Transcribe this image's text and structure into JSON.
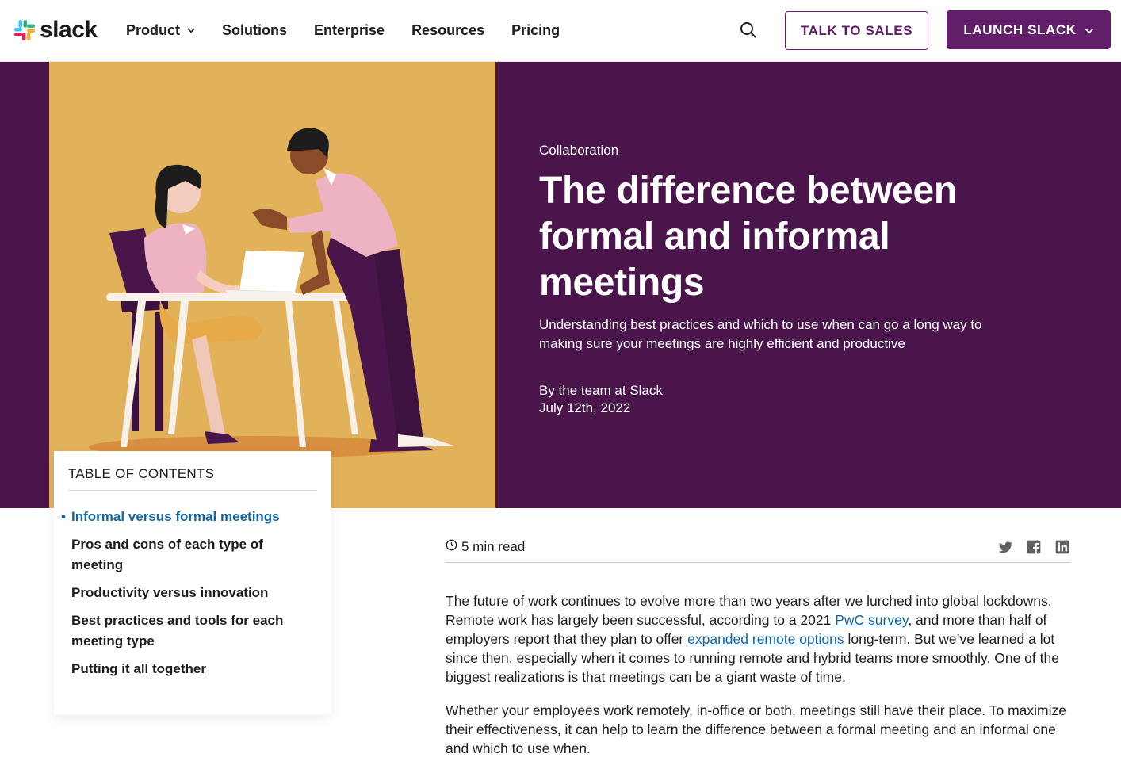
{
  "nav": {
    "logo_text": "slack",
    "links": [
      {
        "label": "Product"
      },
      {
        "label": "Solutions"
      },
      {
        "label": "Enterprise"
      },
      {
        "label": "Resources"
      },
      {
        "label": "Pricing"
      }
    ],
    "talk_to_sales": "TALK TO SALES",
    "launch_slack": "LAUNCH SLACK"
  },
  "hero": {
    "category": "Collaboration",
    "title": "The difference between formal and informal meetings",
    "subtitle": "Understanding best practices and which to use when can go a long way to making sure your meetings are highly efficient and productive",
    "byline": "By the team at Slack",
    "date": "July 12th, 2022"
  },
  "toc": {
    "title": "TABLE OF CONTENTS",
    "items": [
      {
        "label": "Informal versus formal meetings",
        "active": true
      },
      {
        "label": "Pros and cons of each type of meeting",
        "active": false
      },
      {
        "label": "Productivity versus innovation",
        "active": false
      },
      {
        "label": "Best practices and tools for each meeting type",
        "active": false
      },
      {
        "label": "Putting it all together",
        "active": false
      }
    ]
  },
  "article": {
    "read_time": "5 min read",
    "share_icons": [
      "twitter-icon",
      "facebook-icon",
      "linkedin-icon"
    ],
    "p1_a": "The future of work continues to evolve more than two years after we lurched into global lockdowns. Remote work has largely been successful, according to a 2021 ",
    "p1_link1": "PwC survey",
    "p1_b": ", and more than half of employers report that they plan to offer ",
    "p1_link2": "expanded remote options",
    "p1_c": " long-term. But we’ve learned a lot since then, especially when it comes to running remote and hybrid teams more smoothly. One of the biggest realizations is that meetings can be a giant waste of time.",
    "p2": "Whether your employees work remotely, in-office or both, meetings still have their place. To maximize their effectiveness, it can help to learn the difference between a formal meeting and an informal one and which to use when."
  },
  "colors": {
    "aubergine": "#4a154b",
    "brand_purple": "#611f69",
    "mustard": "#e1b25a",
    "link_blue": "#1264a3"
  }
}
